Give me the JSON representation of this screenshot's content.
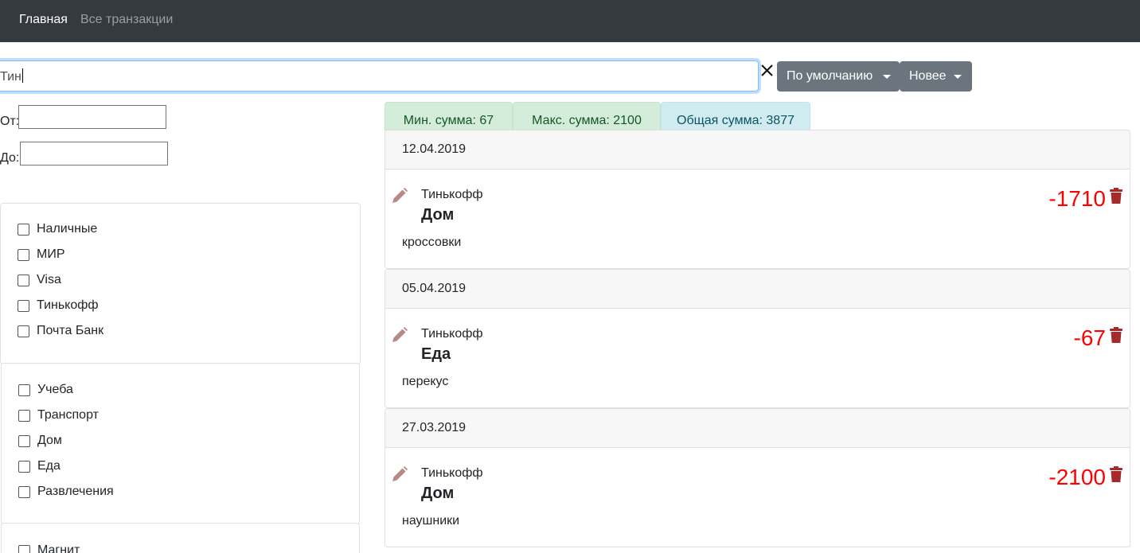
{
  "nav": {
    "home": "Главная",
    "all_transactions": "Все транзакции"
  },
  "search": {
    "value": "Тин",
    "clear_icon": "close-icon"
  },
  "sort": {
    "order_label": "По умолчанию",
    "direction_label": "Новее"
  },
  "date_filter": {
    "from_label": "От:",
    "from_value": "",
    "to_label": "До:",
    "to_value": ""
  },
  "accounts": [
    {
      "label": "Наличные",
      "checked": false
    },
    {
      "label": "МИР",
      "checked": false
    },
    {
      "label": "Visa",
      "checked": false
    },
    {
      "label": "Тинькофф",
      "checked": false
    },
    {
      "label": "Почта Банк",
      "checked": false
    }
  ],
  "categories": [
    {
      "label": "Учеба",
      "checked": false
    },
    {
      "label": "Транспорт",
      "checked": false
    },
    {
      "label": "Дом",
      "checked": false
    },
    {
      "label": "Еда",
      "checked": false
    },
    {
      "label": "Развлечения",
      "checked": false
    }
  ],
  "shops": [
    {
      "label": "Магнит",
      "checked": false
    }
  ],
  "stats": {
    "min": "Мин. сумма: 67",
    "max": "Макс. сумма: 2100",
    "total": "Общая сумма: 3877"
  },
  "transactions": [
    {
      "date": "12.04.2019",
      "account": "Тинькофф",
      "category": "Дом",
      "note": "кроссовки",
      "amount": "-1710"
    },
    {
      "date": "05.04.2019",
      "account": "Тинькофф",
      "category": "Еда",
      "note": "перекус",
      "amount": "-67"
    },
    {
      "date": "27.03.2019",
      "account": "Тинькофф",
      "category": "Дом",
      "note": "наушники",
      "amount": "-2100"
    }
  ],
  "colors": {
    "navbar": "#343a40",
    "amount_negative": "#ff0000",
    "trash": "#a52a2a",
    "edit": "#b68a86",
    "button": "#6c757d"
  },
  "icons": {
    "edit": "pencil-icon",
    "delete": "trash-icon"
  }
}
